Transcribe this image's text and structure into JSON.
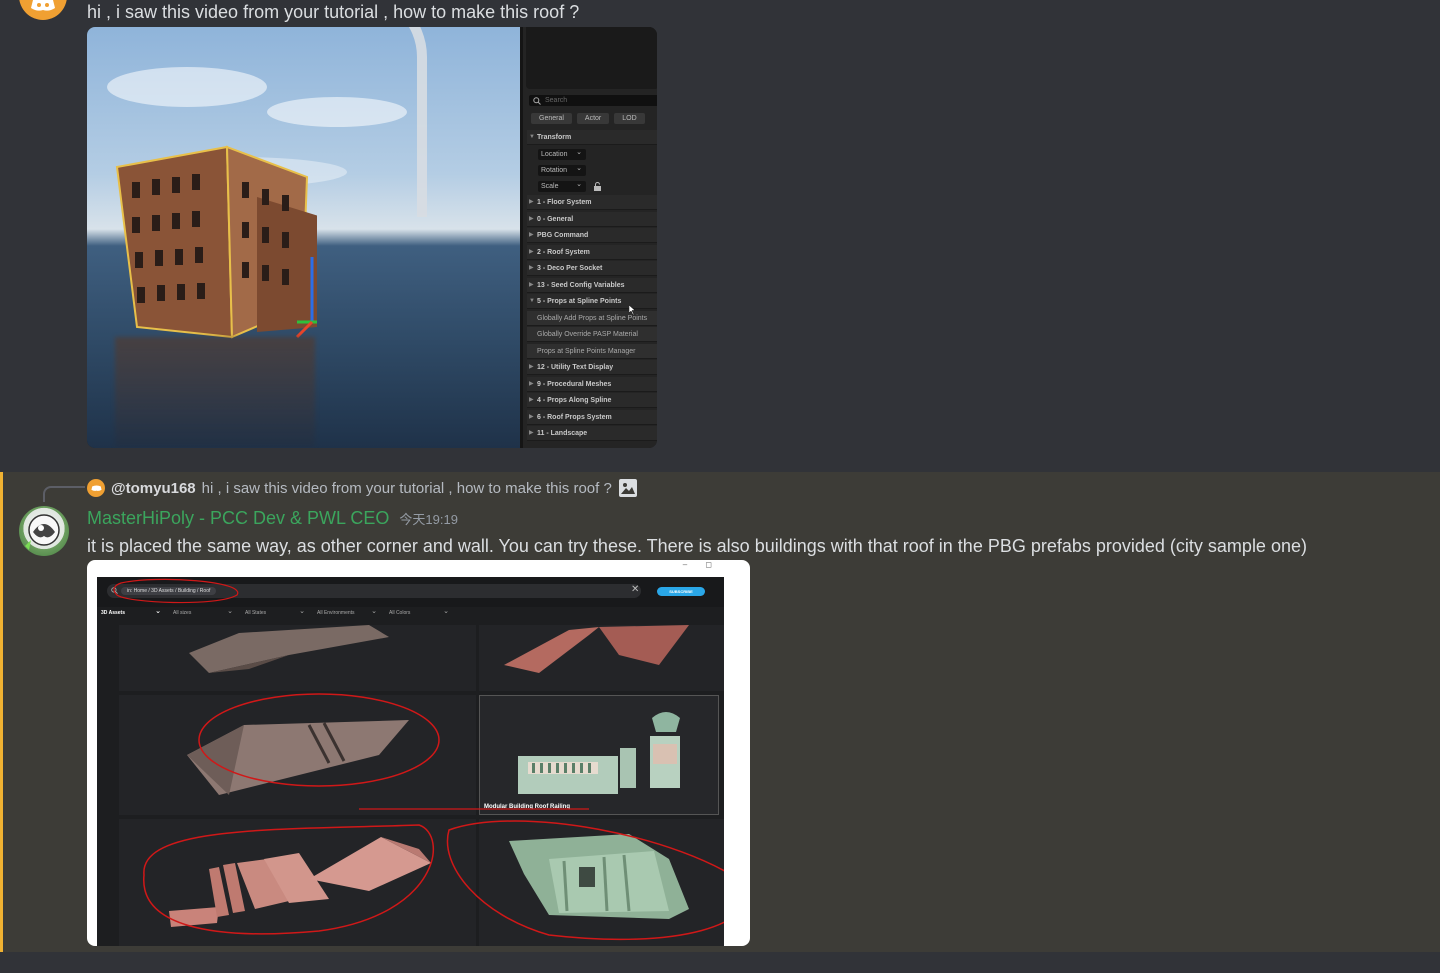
{
  "message1": {
    "text": "hi , i saw this video from your tutorial , how to make this roof ?",
    "image": {
      "search_placeholder": "Search",
      "tabs": [
        "General",
        "Actor",
        "LOD"
      ],
      "sections": {
        "transform": "Transform",
        "location": "Location",
        "rotation": "Rotation",
        "scale": "Scale",
        "items": [
          "1 - Floor System",
          "0 - General",
          "PBG Command",
          "2 - Roof System",
          "3 - Deco Per Socket",
          "13 - Seed Config Variables",
          "5 - Props at Spline Points"
        ],
        "subitems": [
          "Globally Add Props at Spline Points",
          "Globally Override PASP Material",
          "Props at Spline Points Manager"
        ],
        "items_after": [
          "12 - Utility Text Display",
          "9 - Procedural Meshes",
          "4 - Props Along Spline",
          "6 - Roof Props System",
          "11 - Landscape"
        ]
      }
    }
  },
  "message2": {
    "reply_username": "@tomyu168",
    "reply_text": "hi , i saw this video from your tutorial , how to make this roof ?",
    "username": "MasterHiPoly - PCC Dev & PWL CEO",
    "timestamp": "今天19:19",
    "text": "it is placed the same way, as other corner and wall. You can try these. There is also buildings with that roof in the PBG prefabs provided (city sample one)",
    "image": {
      "breadcrumb": "in: Home / 3D Assets / Building / Roof",
      "subscribe": "SUBSCRIBE",
      "filters": [
        "3D Assets",
        "All sizes",
        "All States",
        "All Environments",
        "All Colors"
      ],
      "selected_card_label": "Modular Building Roof Railing"
    }
  },
  "colors": {
    "background": "#313338",
    "highlight_bg": "#3d3c37",
    "highlight_border": "#f0b232",
    "username_green": "#3ba55d",
    "annotation_red": "#d01818"
  }
}
